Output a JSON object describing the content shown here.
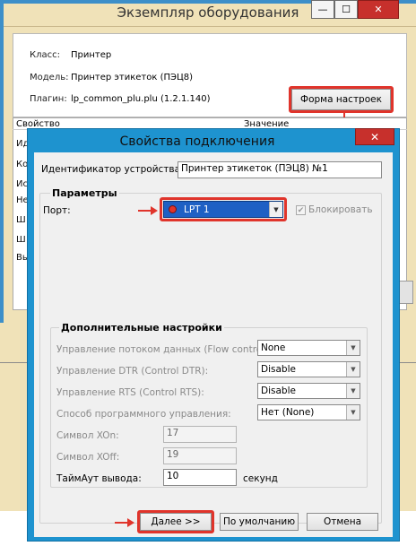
{
  "outer_window": {
    "title": "Экземпляр оборудования",
    "controls": {
      "minimize": "—",
      "maximize": "☐",
      "close": "✕"
    },
    "info": {
      "class_label": "Класс:",
      "class_value": "Принтер",
      "model_label": "Модель:",
      "model_value": "Принтер этикеток (ПЭЦ8)",
      "plugin_label": "Плагин:",
      "plugin_value": "lp_common_plu.plu (1.2.1.140)"
    },
    "settings_button": "Форма настроек",
    "list_headers": {
      "property": "Свойство",
      "value": "Значение"
    },
    "list_rows": [
      "Ид",
      "Ко",
      "Ис",
      "Не",
      "Ш",
      "Ш",
      "Вы"
    ]
  },
  "dialog": {
    "title": "Свойства подключения",
    "close": "✕",
    "device_id_label": "Идентификатор устройства:",
    "device_id_value": "Принтер этикеток (ПЭЦ8) №1",
    "params_group_title": "Параметры",
    "port_label": "Порт:",
    "port_value": "LPT 1",
    "block_label": "Блокировать",
    "advanced_group_title": "Дополнительные настройки",
    "flow_control_label": "Управление потоком данных (Flow control):",
    "flow_control_value": "None",
    "dtr_label": "Управление DTR (Control DTR):",
    "dtr_value": "Disable",
    "rts_label": "Управление RTS (Control RTS):",
    "rts_value": "Disable",
    "soft_control_label": "Способ программного управления:",
    "soft_control_value": "Нет (None)",
    "xon_label": "Символ XOn:",
    "xon_value": "17",
    "xoff_label": "Символ XOff:",
    "xoff_value": "19",
    "timeout_label": "ТаймАут вывода:",
    "timeout_value": "10",
    "timeout_unit": "секунд",
    "next_button": "Далее >>",
    "default_button": "По умолчанию",
    "cancel_button": "Отмена"
  },
  "colors": {
    "highlight": "#e0342b",
    "dialog_frame": "#1e93cf",
    "outer_window": "#f0e2b8",
    "selected_port": "#1f60c4"
  }
}
